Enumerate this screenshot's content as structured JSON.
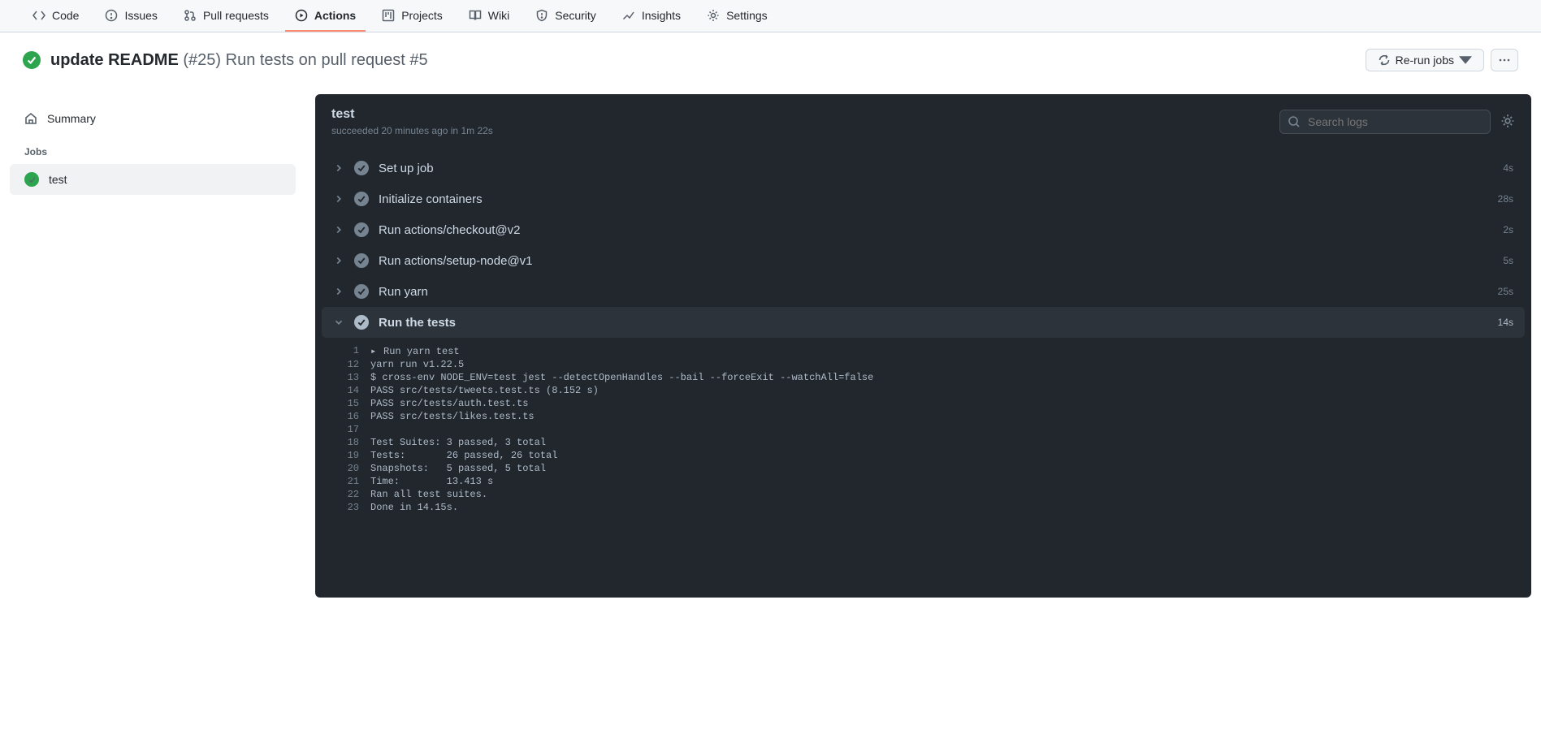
{
  "tabs": [
    {
      "label": "Code"
    },
    {
      "label": "Issues"
    },
    {
      "label": "Pull requests"
    },
    {
      "label": "Actions"
    },
    {
      "label": "Projects"
    },
    {
      "label": "Wiki"
    },
    {
      "label": "Security"
    },
    {
      "label": "Insights"
    },
    {
      "label": "Settings"
    }
  ],
  "header": {
    "title": "update README",
    "pr_num": "(#25)",
    "subtitle": "Run tests on pull request #5",
    "rerun_label": "Re-run jobs"
  },
  "sidebar": {
    "summary_label": "Summary",
    "jobs_label": "Jobs",
    "jobs": [
      {
        "label": "test"
      }
    ]
  },
  "panel": {
    "title": "test",
    "status_text": "succeeded 20 minutes ago in 1m 22s",
    "search_placeholder": "Search logs"
  },
  "steps": [
    {
      "name": "Set up job",
      "duration": "4s",
      "expanded": false
    },
    {
      "name": "Initialize containers",
      "duration": "28s",
      "expanded": false
    },
    {
      "name": "Run actions/checkout@v2",
      "duration": "2s",
      "expanded": false
    },
    {
      "name": "Run actions/setup-node@v1",
      "duration": "5s",
      "expanded": false
    },
    {
      "name": "Run yarn",
      "duration": "25s",
      "expanded": false
    },
    {
      "name": "Run the tests",
      "duration": "14s",
      "expanded": true
    }
  ],
  "log": [
    {
      "n": "1",
      "t": "Run yarn test",
      "play": true
    },
    {
      "n": "12",
      "t": "yarn run v1.22.5"
    },
    {
      "n": "13",
      "t": "$ cross-env NODE_ENV=test jest --detectOpenHandles --bail --forceExit --watchAll=false"
    },
    {
      "n": "14",
      "t": "PASS src/tests/tweets.test.ts (8.152 s)"
    },
    {
      "n": "15",
      "t": "PASS src/tests/auth.test.ts"
    },
    {
      "n": "16",
      "t": "PASS src/tests/likes.test.ts"
    },
    {
      "n": "17",
      "t": ""
    },
    {
      "n": "18",
      "t": "Test Suites: 3 passed, 3 total"
    },
    {
      "n": "19",
      "t": "Tests:       26 passed, 26 total"
    },
    {
      "n": "20",
      "t": "Snapshots:   5 passed, 5 total"
    },
    {
      "n": "21",
      "t": "Time:        13.413 s"
    },
    {
      "n": "22",
      "t": "Ran all test suites."
    },
    {
      "n": "23",
      "t": "Done in 14.15s."
    }
  ]
}
